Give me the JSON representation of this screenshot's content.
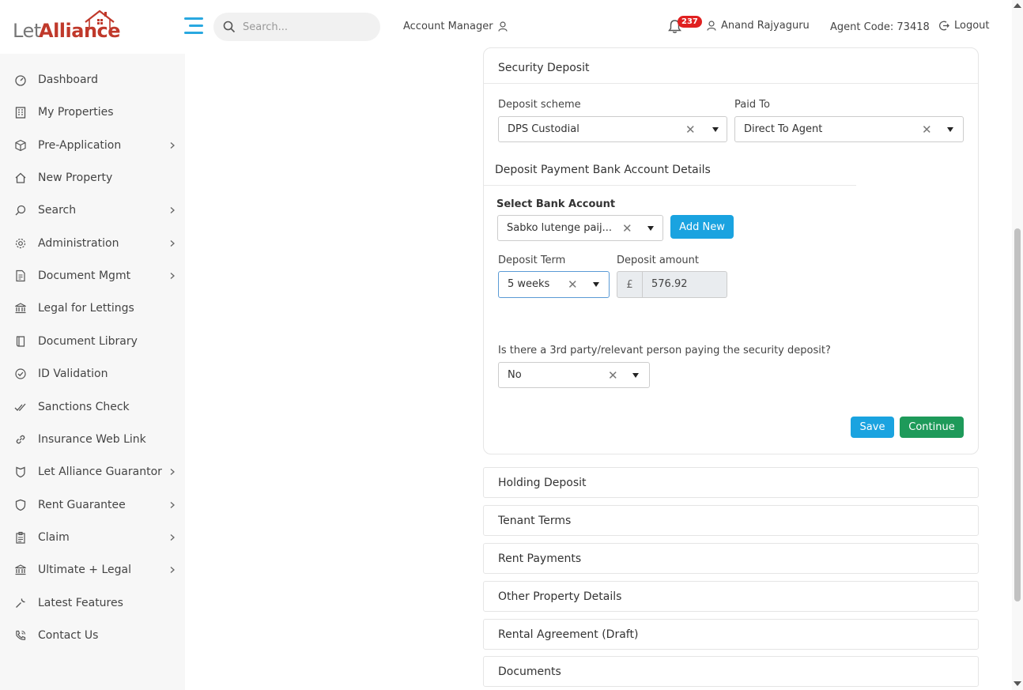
{
  "brand": {
    "logo_let": "Let",
    "logo_alliance": "Alliance",
    "brand_color": "#c0392b",
    "accent": "#29a8e0"
  },
  "header": {
    "search_placeholder": "Search...",
    "account_manager": "Account Manager",
    "notification_count": "237",
    "user_name": "Anand Rajyaguru",
    "agent_code": "Agent Code: 73418",
    "logout": "Logout"
  },
  "sidebar": {
    "items": [
      {
        "label": "Dashboard",
        "icon": "dashboard-icon",
        "has_children": false
      },
      {
        "label": "My Properties",
        "icon": "building-icon",
        "has_children": false
      },
      {
        "label": "Pre-Application",
        "icon": "box-icon",
        "has_children": true
      },
      {
        "label": "New Property",
        "icon": "home-icon",
        "has_children": false
      },
      {
        "label": "Search",
        "icon": "search-icon",
        "has_children": true
      },
      {
        "label": "Administration",
        "icon": "gear-icon",
        "has_children": true
      },
      {
        "label": "Document Mgmt",
        "icon": "document-icon",
        "has_children": true
      },
      {
        "label": "Legal for Lettings",
        "icon": "bank-icon",
        "has_children": false
      },
      {
        "label": "Document Library",
        "icon": "book-icon",
        "has_children": false
      },
      {
        "label": "ID Validation",
        "icon": "check-circle-icon",
        "has_children": false
      },
      {
        "label": "Sanctions Check",
        "icon": "double-check-icon",
        "has_children": false
      },
      {
        "label": "Insurance Web Link",
        "icon": "link-icon",
        "has_children": false
      },
      {
        "label": "Let Alliance Guarantor",
        "icon": "shield-icon",
        "has_children": true
      },
      {
        "label": "Rent Guarantee",
        "icon": "shield-outline-icon",
        "has_children": true
      },
      {
        "label": "Claim",
        "icon": "clipboard-icon",
        "has_children": true
      },
      {
        "label": "Ultimate + Legal",
        "icon": "bank-icon",
        "has_children": true
      },
      {
        "label": "Latest Features",
        "icon": "wrench-icon",
        "has_children": false
      },
      {
        "label": "Contact Us",
        "icon": "phone-icon",
        "has_children": false
      }
    ]
  },
  "security_deposit": {
    "title": "Security Deposit",
    "deposit_scheme_label": "Deposit scheme",
    "deposit_scheme_value": "DPS Custodial",
    "paid_to_label": "Paid To",
    "paid_to_value": "Direct To Agent",
    "bank_section_title": "Deposit Payment Bank Account Details",
    "select_bank_label": "Select Bank Account",
    "select_bank_value": "Sabko lutenge paij...",
    "add_new": "Add New",
    "deposit_term_label": "Deposit Term",
    "deposit_term_value": "5 weeks",
    "deposit_amount_label": "Deposit amount",
    "currency_symbol": "£",
    "deposit_amount_value": "576.92",
    "third_party_question": "Is there a 3rd party/relevant person paying the security deposit?",
    "third_party_value": "No",
    "save": "Save",
    "continue": "Continue"
  },
  "accordion": [
    "Holding Deposit",
    "Tenant Terms",
    "Rent Payments",
    "Other Property Details",
    "Rental Agreement (Draft)",
    "Documents"
  ]
}
